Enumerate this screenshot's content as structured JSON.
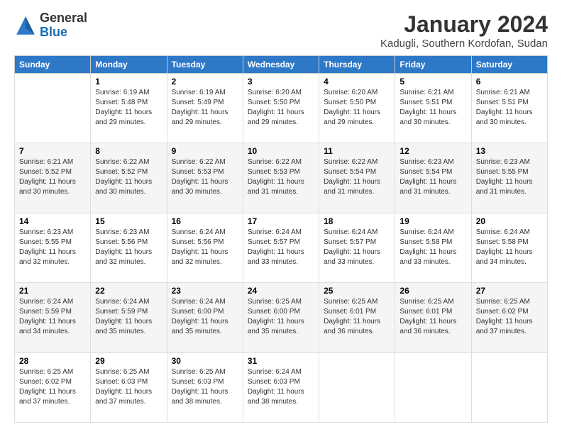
{
  "logo": {
    "general": "General",
    "blue": "Blue"
  },
  "title": "January 2024",
  "subtitle": "Kadugli, Southern Kordofan, Sudan",
  "days_header": [
    "Sunday",
    "Monday",
    "Tuesday",
    "Wednesday",
    "Thursday",
    "Friday",
    "Saturday"
  ],
  "weeks": [
    [
      {
        "day": "",
        "sunrise": "",
        "sunset": "",
        "daylight": ""
      },
      {
        "day": "1",
        "sunrise": "Sunrise: 6:19 AM",
        "sunset": "Sunset: 5:48 PM",
        "daylight": "Daylight: 11 hours and 29 minutes."
      },
      {
        "day": "2",
        "sunrise": "Sunrise: 6:19 AM",
        "sunset": "Sunset: 5:49 PM",
        "daylight": "Daylight: 11 hours and 29 minutes."
      },
      {
        "day": "3",
        "sunrise": "Sunrise: 6:20 AM",
        "sunset": "Sunset: 5:50 PM",
        "daylight": "Daylight: 11 hours and 29 minutes."
      },
      {
        "day": "4",
        "sunrise": "Sunrise: 6:20 AM",
        "sunset": "Sunset: 5:50 PM",
        "daylight": "Daylight: 11 hours and 29 minutes."
      },
      {
        "day": "5",
        "sunrise": "Sunrise: 6:21 AM",
        "sunset": "Sunset: 5:51 PM",
        "daylight": "Daylight: 11 hours and 30 minutes."
      },
      {
        "day": "6",
        "sunrise": "Sunrise: 6:21 AM",
        "sunset": "Sunset: 5:51 PM",
        "daylight": "Daylight: 11 hours and 30 minutes."
      }
    ],
    [
      {
        "day": "7",
        "sunrise": "Sunrise: 6:21 AM",
        "sunset": "Sunset: 5:52 PM",
        "daylight": "Daylight: 11 hours and 30 minutes."
      },
      {
        "day": "8",
        "sunrise": "Sunrise: 6:22 AM",
        "sunset": "Sunset: 5:52 PM",
        "daylight": "Daylight: 11 hours and 30 minutes."
      },
      {
        "day": "9",
        "sunrise": "Sunrise: 6:22 AM",
        "sunset": "Sunset: 5:53 PM",
        "daylight": "Daylight: 11 hours and 30 minutes."
      },
      {
        "day": "10",
        "sunrise": "Sunrise: 6:22 AM",
        "sunset": "Sunset: 5:53 PM",
        "daylight": "Daylight: 11 hours and 31 minutes."
      },
      {
        "day": "11",
        "sunrise": "Sunrise: 6:22 AM",
        "sunset": "Sunset: 5:54 PM",
        "daylight": "Daylight: 11 hours and 31 minutes."
      },
      {
        "day": "12",
        "sunrise": "Sunrise: 6:23 AM",
        "sunset": "Sunset: 5:54 PM",
        "daylight": "Daylight: 11 hours and 31 minutes."
      },
      {
        "day": "13",
        "sunrise": "Sunrise: 6:23 AM",
        "sunset": "Sunset: 5:55 PM",
        "daylight": "Daylight: 11 hours and 31 minutes."
      }
    ],
    [
      {
        "day": "14",
        "sunrise": "Sunrise: 6:23 AM",
        "sunset": "Sunset: 5:55 PM",
        "daylight": "Daylight: 11 hours and 32 minutes."
      },
      {
        "day": "15",
        "sunrise": "Sunrise: 6:23 AM",
        "sunset": "Sunset: 5:56 PM",
        "daylight": "Daylight: 11 hours and 32 minutes."
      },
      {
        "day": "16",
        "sunrise": "Sunrise: 6:24 AM",
        "sunset": "Sunset: 5:56 PM",
        "daylight": "Daylight: 11 hours and 32 minutes."
      },
      {
        "day": "17",
        "sunrise": "Sunrise: 6:24 AM",
        "sunset": "Sunset: 5:57 PM",
        "daylight": "Daylight: 11 hours and 33 minutes."
      },
      {
        "day": "18",
        "sunrise": "Sunrise: 6:24 AM",
        "sunset": "Sunset: 5:57 PM",
        "daylight": "Daylight: 11 hours and 33 minutes."
      },
      {
        "day": "19",
        "sunrise": "Sunrise: 6:24 AM",
        "sunset": "Sunset: 5:58 PM",
        "daylight": "Daylight: 11 hours and 33 minutes."
      },
      {
        "day": "20",
        "sunrise": "Sunrise: 6:24 AM",
        "sunset": "Sunset: 5:58 PM",
        "daylight": "Daylight: 11 hours and 34 minutes."
      }
    ],
    [
      {
        "day": "21",
        "sunrise": "Sunrise: 6:24 AM",
        "sunset": "Sunset: 5:59 PM",
        "daylight": "Daylight: 11 hours and 34 minutes."
      },
      {
        "day": "22",
        "sunrise": "Sunrise: 6:24 AM",
        "sunset": "Sunset: 5:59 PM",
        "daylight": "Daylight: 11 hours and 35 minutes."
      },
      {
        "day": "23",
        "sunrise": "Sunrise: 6:24 AM",
        "sunset": "Sunset: 6:00 PM",
        "daylight": "Daylight: 11 hours and 35 minutes."
      },
      {
        "day": "24",
        "sunrise": "Sunrise: 6:25 AM",
        "sunset": "Sunset: 6:00 PM",
        "daylight": "Daylight: 11 hours and 35 minutes."
      },
      {
        "day": "25",
        "sunrise": "Sunrise: 6:25 AM",
        "sunset": "Sunset: 6:01 PM",
        "daylight": "Daylight: 11 hours and 36 minutes."
      },
      {
        "day": "26",
        "sunrise": "Sunrise: 6:25 AM",
        "sunset": "Sunset: 6:01 PM",
        "daylight": "Daylight: 11 hours and 36 minutes."
      },
      {
        "day": "27",
        "sunrise": "Sunrise: 6:25 AM",
        "sunset": "Sunset: 6:02 PM",
        "daylight": "Daylight: 11 hours and 37 minutes."
      }
    ],
    [
      {
        "day": "28",
        "sunrise": "Sunrise: 6:25 AM",
        "sunset": "Sunset: 6:02 PM",
        "daylight": "Daylight: 11 hours and 37 minutes."
      },
      {
        "day": "29",
        "sunrise": "Sunrise: 6:25 AM",
        "sunset": "Sunset: 6:03 PM",
        "daylight": "Daylight: 11 hours and 37 minutes."
      },
      {
        "day": "30",
        "sunrise": "Sunrise: 6:25 AM",
        "sunset": "Sunset: 6:03 PM",
        "daylight": "Daylight: 11 hours and 38 minutes."
      },
      {
        "day": "31",
        "sunrise": "Sunrise: 6:24 AM",
        "sunset": "Sunset: 6:03 PM",
        "daylight": "Daylight: 11 hours and 38 minutes."
      },
      {
        "day": "",
        "sunrise": "",
        "sunset": "",
        "daylight": ""
      },
      {
        "day": "",
        "sunrise": "",
        "sunset": "",
        "daylight": ""
      },
      {
        "day": "",
        "sunrise": "",
        "sunset": "",
        "daylight": ""
      }
    ]
  ]
}
